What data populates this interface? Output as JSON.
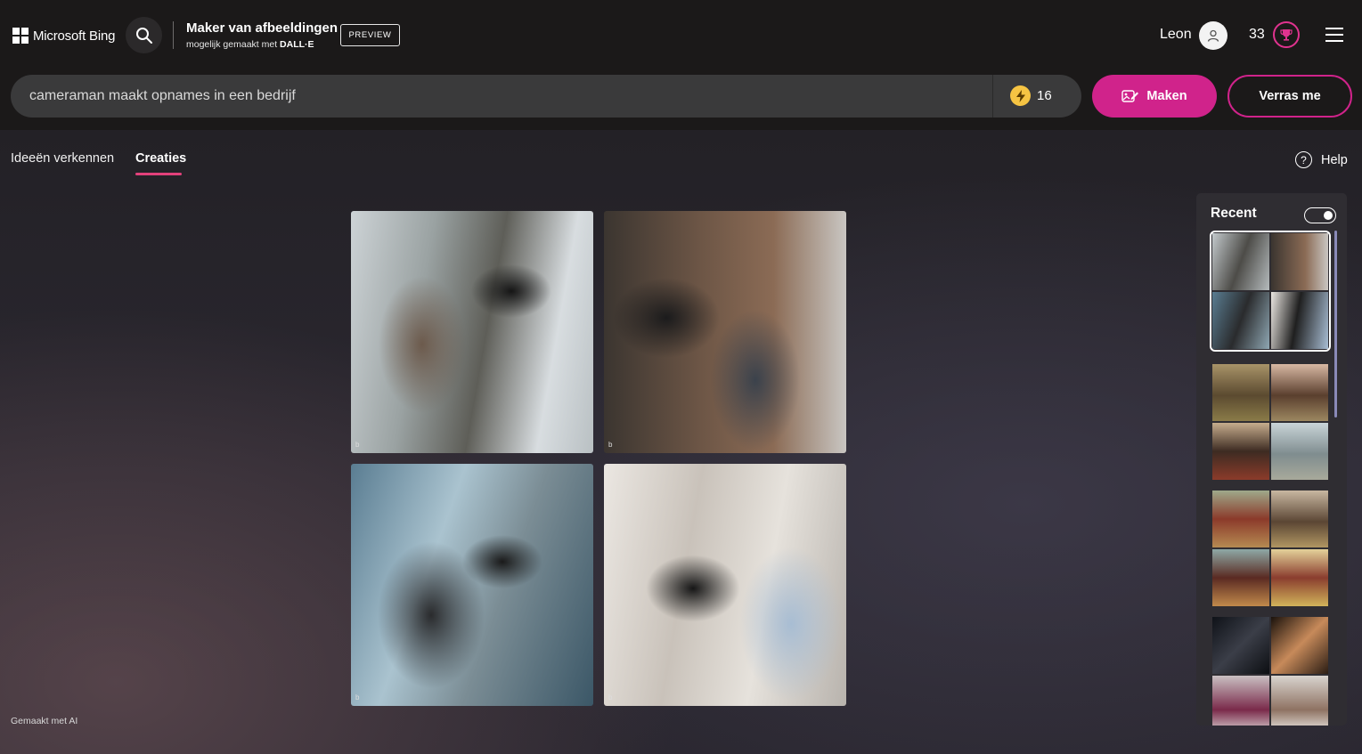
{
  "header": {
    "logo_text": "Microsoft Bing",
    "app_title": "Maker van afbeeldingen",
    "app_subtitle_prefix": "mogelijk gemaakt met ",
    "app_subtitle_brand": "DALL·E",
    "badge": "PREVIEW",
    "user_name": "Leon",
    "rewards_points": "33"
  },
  "prompt": {
    "value": "cameraman maakt opnames in een bedrijf",
    "boosts": "16",
    "make_label": "Maken",
    "surprise_label": "Verras me"
  },
  "tabs": [
    {
      "label": "Ideeën verkennen",
      "active": false
    },
    {
      "label": "Creaties",
      "active": true
    }
  ],
  "help_label": "Help",
  "footer_note": "Gemaakt met AI",
  "recent": {
    "title": "Recent",
    "toggle_on": true
  },
  "colors": {
    "accent": "#d0238b",
    "boost": "#f6c443",
    "tab_underline": "#e2417b"
  },
  "icons": {
    "search": "search-icon",
    "avatar": "user-icon",
    "rewards": "trophy-icon",
    "menu": "hamburger-menu-icon",
    "boost": "lightning-icon",
    "make": "image-create-icon",
    "help": "help-icon"
  }
}
